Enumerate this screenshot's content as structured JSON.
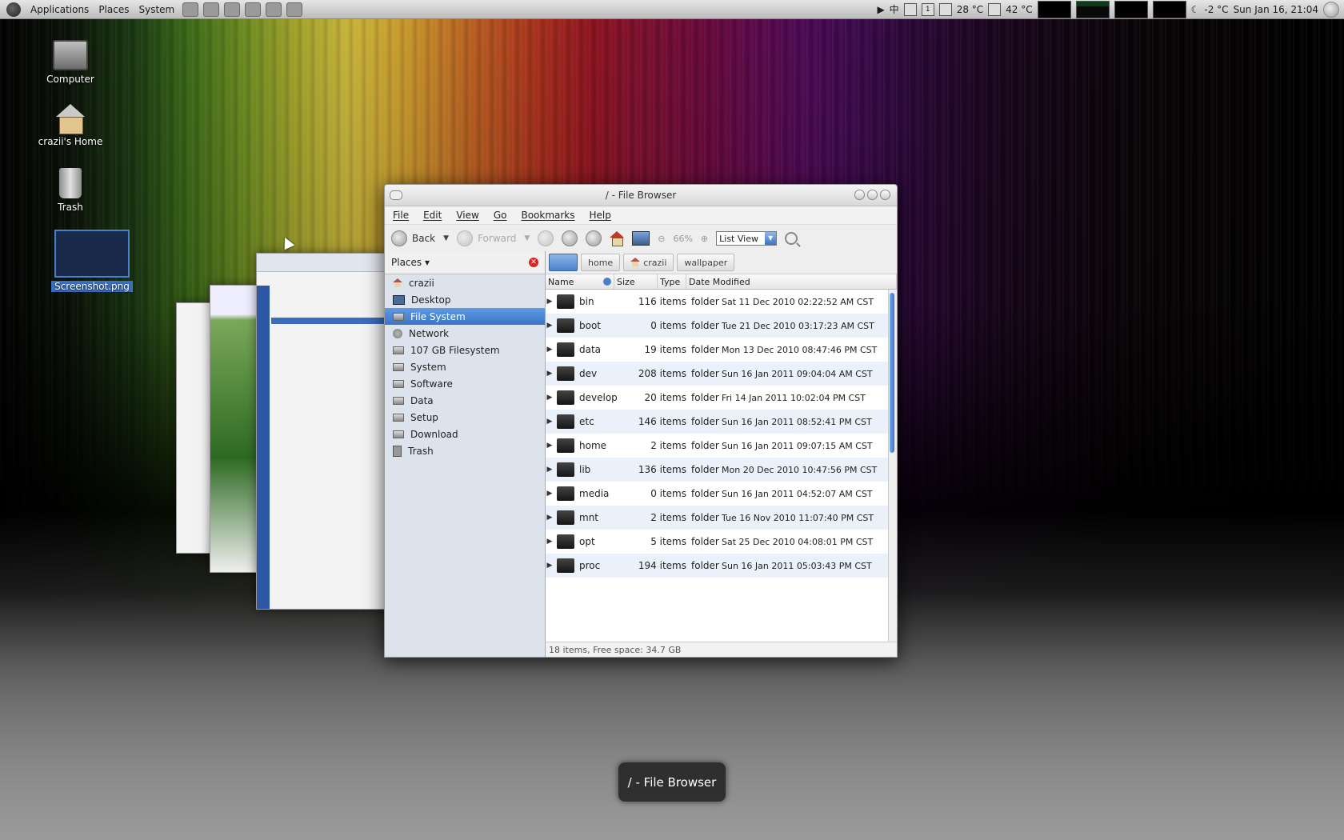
{
  "top_panel": {
    "menus": [
      "Applications",
      "Places",
      "System"
    ],
    "ime": "中",
    "workspace": "1",
    "cpu_temp": "28 °C",
    "gpu_temp": "42 °C",
    "weather": "-2 °C",
    "clock": "Sun Jan 16, 21:04"
  },
  "desktop": {
    "icons": [
      {
        "label": "Computer"
      },
      {
        "label": "crazii's Home"
      },
      {
        "label": "Trash"
      },
      {
        "label": "Screenshot.png"
      }
    ]
  },
  "file_browser": {
    "title": "/ - File Browser",
    "menu": [
      "File",
      "Edit",
      "View",
      "Go",
      "Bookmarks",
      "Help"
    ],
    "toolbar": {
      "back": "Back",
      "forward": "Forward",
      "zoom": "66%",
      "view_mode": "List View"
    },
    "places_label": "Places",
    "sidebar": [
      {
        "label": "crazii",
        "icon": "home-icon"
      },
      {
        "label": "Desktop",
        "icon": "desktop-icon"
      },
      {
        "label": "File System",
        "icon": "drive-icon",
        "selected": true
      },
      {
        "label": "Network",
        "icon": "network-icon"
      },
      {
        "label": "107 GB Filesystem",
        "icon": "drive-icon"
      },
      {
        "label": "System",
        "icon": "drive-icon"
      },
      {
        "label": "Software",
        "icon": "drive-icon"
      },
      {
        "label": "Data",
        "icon": "drive-icon"
      },
      {
        "label": "Setup",
        "icon": "drive-icon"
      },
      {
        "label": "Download",
        "icon": "drive-icon"
      },
      {
        "label": "Trash",
        "icon": "trash-icon"
      }
    ],
    "path": [
      "home",
      "crazii",
      "wallpaper"
    ],
    "columns": [
      "Name",
      "Size",
      "Type",
      "Date Modified"
    ],
    "rows": [
      {
        "name": "bin",
        "size": "116 items",
        "type": "folder",
        "date": "Sat 11 Dec 2010 02:22:52 AM CST"
      },
      {
        "name": "boot",
        "size": "0 items",
        "type": "folder",
        "date": "Tue 21 Dec 2010 03:17:23 AM CST"
      },
      {
        "name": "data",
        "size": "19 items",
        "type": "folder",
        "date": "Mon 13 Dec 2010 08:47:46 PM CST"
      },
      {
        "name": "dev",
        "size": "208 items",
        "type": "folder",
        "date": "Sun 16 Jan 2011 09:04:04 AM CST"
      },
      {
        "name": "develop",
        "size": "20 items",
        "type": "folder",
        "date": "Fri 14 Jan 2011 10:02:04 PM CST"
      },
      {
        "name": "etc",
        "size": "146 items",
        "type": "folder",
        "date": "Sun 16 Jan 2011 08:52:41 PM CST"
      },
      {
        "name": "home",
        "size": "2 items",
        "type": "folder",
        "date": "Sun 16 Jan 2011 09:07:15 AM CST"
      },
      {
        "name": "lib",
        "size": "136 items",
        "type": "folder",
        "date": "Mon 20 Dec 2010 10:47:56 PM CST"
      },
      {
        "name": "media",
        "size": "0 items",
        "type": "folder",
        "date": "Sun 16 Jan 2011 04:52:07 AM CST"
      },
      {
        "name": "mnt",
        "size": "2 items",
        "type": "folder",
        "date": "Tue 16 Nov 2010 11:07:40 PM CST"
      },
      {
        "name": "opt",
        "size": "5 items",
        "type": "folder",
        "date": "Sat 25 Dec 2010 04:08:01 PM CST"
      },
      {
        "name": "proc",
        "size": "194 items",
        "type": "folder",
        "date": "Sun 16 Jan 2011 05:03:43 PM CST"
      }
    ],
    "status": "18 items, Free space: 34.7 GB"
  },
  "switcher_label": "/ - File Browser"
}
